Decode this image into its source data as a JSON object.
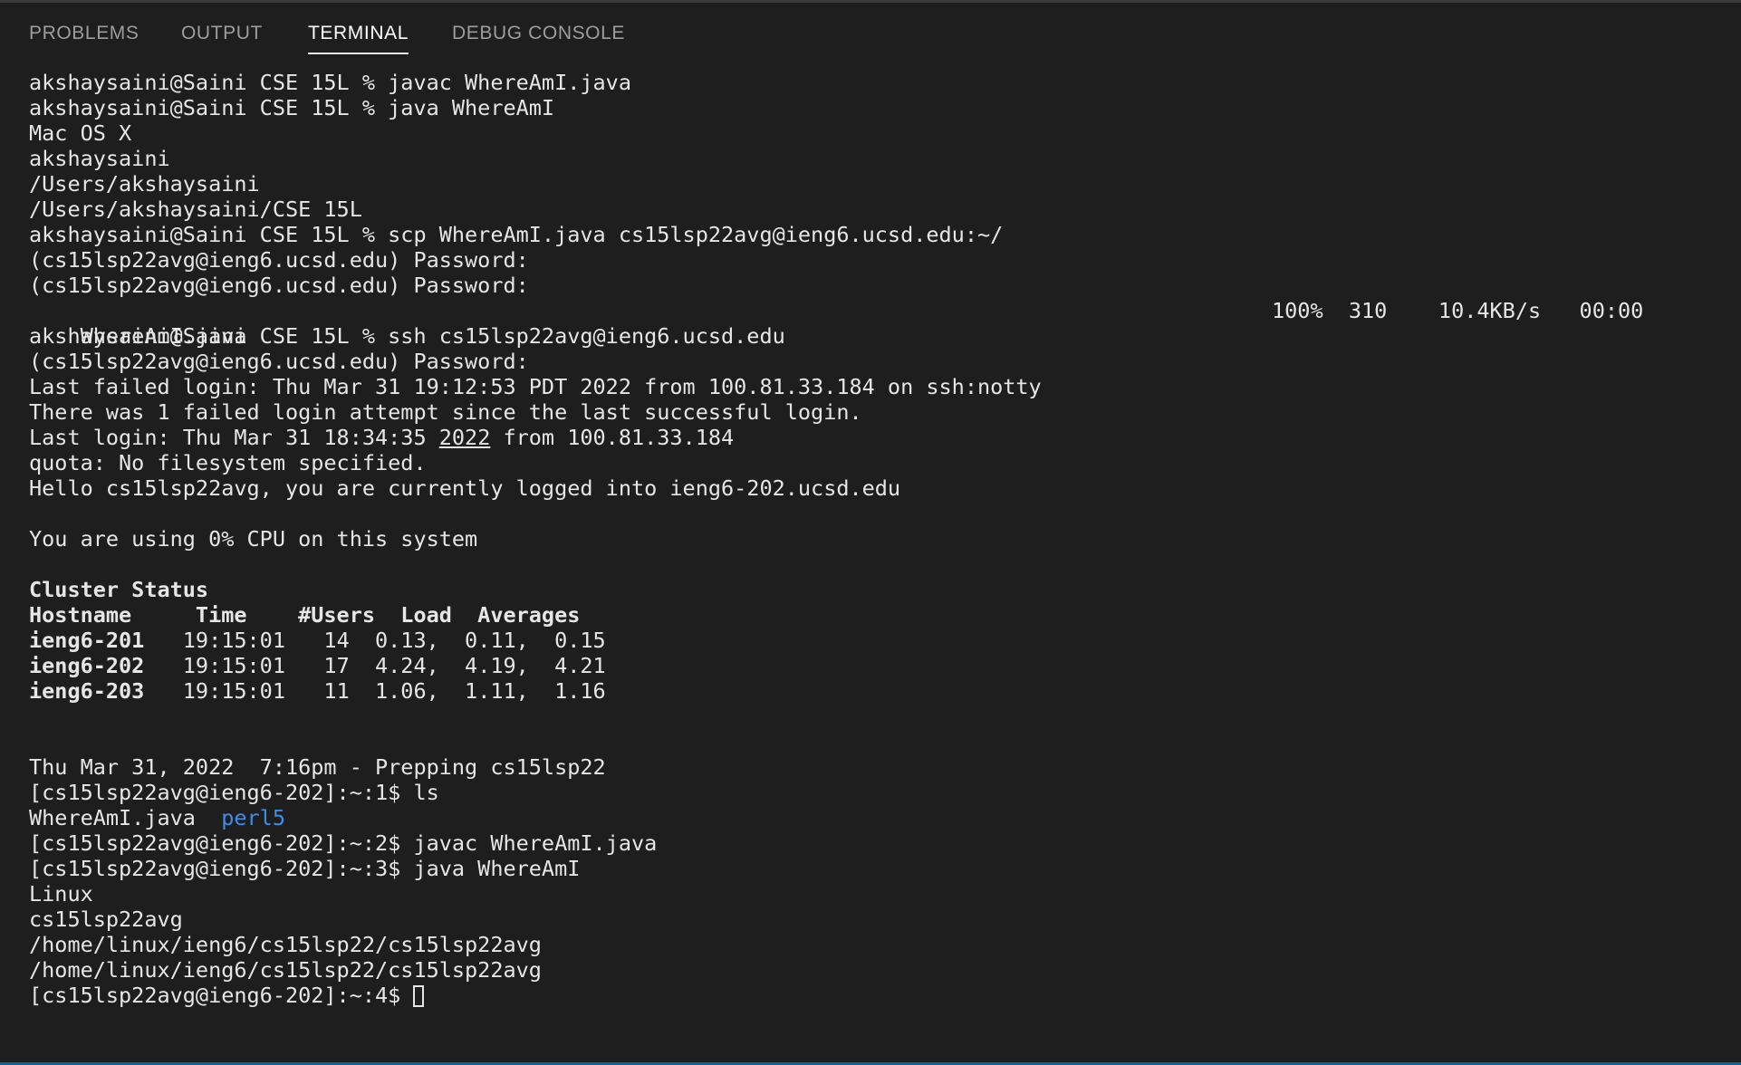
{
  "tabs": {
    "problems": "PROBLEMS",
    "output": "OUTPUT",
    "terminal": "TERMINAL",
    "debug_console": "DEBUG CONSOLE"
  },
  "terminal": {
    "l01": "akshaysaini@Saini CSE 15L % javac WhereAmI.java",
    "l02": "akshaysaini@Saini CSE 15L % java WhereAmI",
    "l03": "Mac OS X",
    "l04": "akshaysaini",
    "l05": "/Users/akshaysaini",
    "l06": "/Users/akshaysaini/CSE 15L",
    "l07": "akshaysaini@Saini CSE 15L % scp WhereAmI.java cs15lsp22avg@ieng6.ucsd.edu:~/",
    "l08": "(cs15lsp22avg@ieng6.ucsd.edu) Password:",
    "l09": "(cs15lsp22avg@ieng6.ucsd.edu) Password:",
    "l10_file": "WhereAmI.java",
    "l10_stats": "100%  310    10.4KB/s   00:00",
    "l11": "akshaysaini@Saini CSE 15L % ssh cs15lsp22avg@ieng6.ucsd.edu",
    "l12": "(cs15lsp22avg@ieng6.ucsd.edu) Password:",
    "l13": "Last failed login: Thu Mar 31 19:12:53 PDT 2022 from 100.81.33.184 on ssh:notty",
    "l14": "There was 1 failed login attempt since the last successful login.",
    "l15_a": "Last login: Thu Mar 31 18:34:35 ",
    "l15_b": "2022",
    "l15_c": " from 100.81.33.184",
    "l16": "quota: No filesystem specified.",
    "l17": "Hello cs15lsp22avg, you are currently logged into ieng6-202.ucsd.edu",
    "l19": "You are using 0% CPU on this system",
    "l21": "Cluster Status",
    "l22": "Hostname     Time    #Users  Load  Averages",
    "l23_host": "ieng6-201",
    "l23_rest": "   19:15:01   14  0.13,  0.11,  0.15",
    "l24_host": "ieng6-202",
    "l24_rest": "   19:15:01   17  4.24,  4.19,  4.21",
    "l25_host": "ieng6-203",
    "l25_rest": "   19:15:01   11  1.06,  1.11,  1.16",
    "l28": "Thu Mar 31, 2022  7:16pm - Prepping cs15lsp22",
    "l29": "[cs15lsp22avg@ieng6-202]:~:1$ ls",
    "l30_file": "WhereAmI.java  ",
    "l30_dir": "perl5",
    "l31": "[cs15lsp22avg@ieng6-202]:~:2$ javac WhereAmI.java",
    "l32": "[cs15lsp22avg@ieng6-202]:~:3$ java WhereAmI",
    "l33": "Linux",
    "l34": "cs15lsp22avg",
    "l35": "/home/linux/ieng6/cs15lsp22/cs15lsp22avg",
    "l36": "/home/linux/ieng6/cs15lsp22/cs15lsp22avg",
    "l37": "[cs15lsp22avg@ieng6-202]:~:4$ "
  }
}
